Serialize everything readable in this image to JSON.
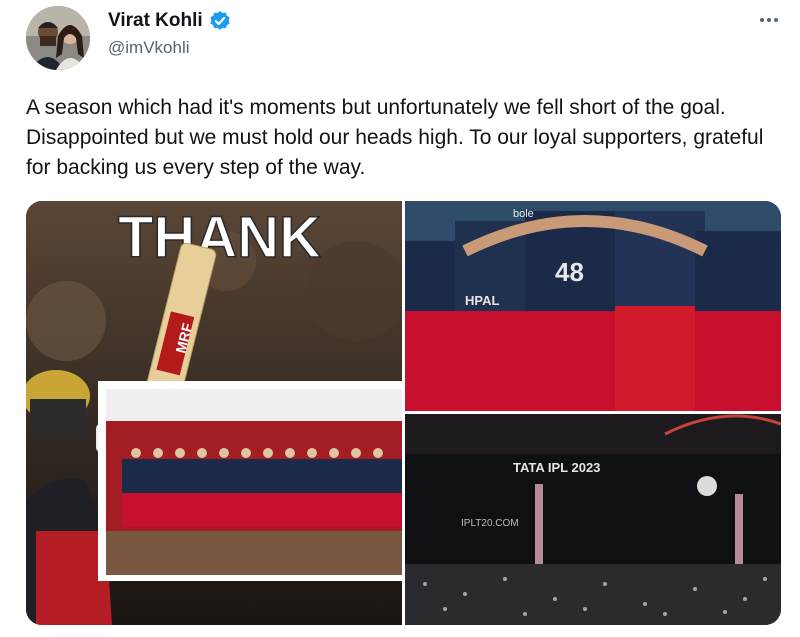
{
  "author": {
    "name": "Virat Kohli",
    "handle": "@imVkohli",
    "verified_color": "#1d9bf0"
  },
  "tweet": {
    "text": "A season which had it's moments but unfortunately we fell short of the goal. Disappointed but we must hold our heads high. To our loyal supporters, grateful for backing us every step of the way."
  },
  "media": {
    "photo1": {
      "headline": "THANK",
      "bat_text": "MRF"
    },
    "photo2": {
      "jersey_number": "48",
      "jersey_text": "HPAL",
      "sponsor": "bole"
    },
    "photo3": {
      "banner": "TATA IPL 2023",
      "board": "IPLT20.COM"
    }
  },
  "colors": {
    "text": "#0f1419",
    "secondary": "#536471",
    "rcb_red": "#c8102e",
    "rcb_navy": "#1c2a4a"
  },
  "icons": [
    "verified-badge-icon",
    "more-options-icon"
  ]
}
